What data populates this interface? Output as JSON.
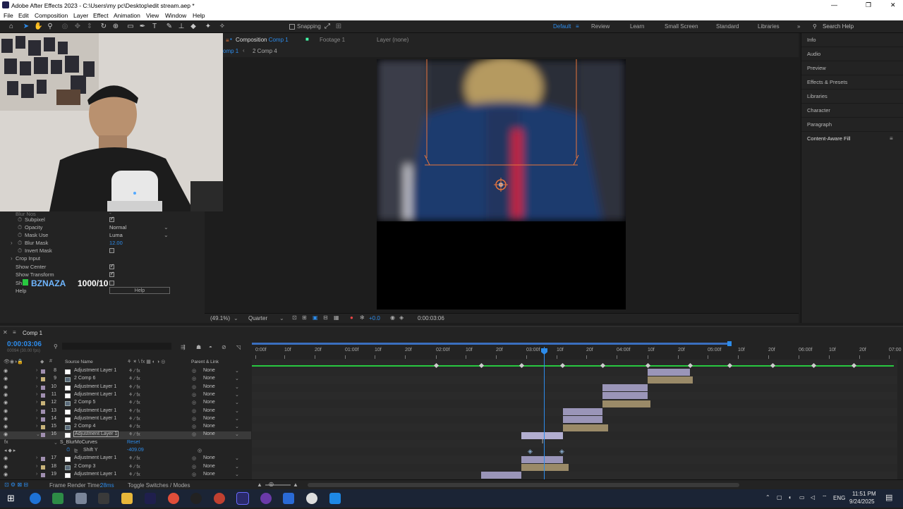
{
  "window": {
    "title": "Adobe After Effects 2023 - C:\\Users\\my pc\\Desktop\\edit stream.aep *",
    "minimize": "—",
    "restore": "❐",
    "close": "✕"
  },
  "menu": [
    "File",
    "Edit",
    "Composition",
    "Layer",
    "Effect",
    "Animation",
    "View",
    "Window",
    "Help"
  ],
  "toolbar": {
    "snapping": "Snapping",
    "workspaces": [
      "Default",
      "Review",
      "Learn",
      "Small Screen",
      "Standard",
      "Libraries"
    ],
    "active_workspace": "Default",
    "search_help": "Search Help"
  },
  "composition_panel": {
    "tabs": [
      "Composition",
      "Footage",
      "Layer (none)"
    ],
    "composition_name": "Comp 1",
    "footage_name": "1",
    "breadcrumb": [
      "omp 1",
      "2 Comp 4"
    ]
  },
  "viewer_footer": {
    "zoom": "(49.1%)",
    "resolution": "Quarter",
    "exposure": "+0.0",
    "timecode": "0:00:03:06"
  },
  "effect_controls": {
    "props": [
      {
        "label": "Subpixel",
        "type": "checkbox",
        "checked": true
      },
      {
        "label": "Opacity",
        "type": "dropdown",
        "value": "Normal"
      },
      {
        "label": "Mask Use",
        "type": "dropdown",
        "value": "Luma"
      },
      {
        "label": "Blur Mask",
        "type": "value",
        "value": "12.00"
      },
      {
        "label": "Invert Mask",
        "type": "checkbox",
        "checked": false
      },
      {
        "label": "Crop Input",
        "type": "group"
      },
      {
        "label": "Show Center",
        "type": "checkbox",
        "checked": true
      },
      {
        "label": "Show Transform",
        "type": "checkbox",
        "checked": true
      },
      {
        "label": "Sh",
        "type": "checkbox",
        "checked": false
      },
      {
        "label": "Help",
        "type": "button",
        "value": "Help"
      }
    ],
    "overlay_brand": "BZNAZA",
    "overlay_count": "1000/10"
  },
  "right_panel": {
    "items": [
      "Info",
      "Audio",
      "Preview",
      "Effects & Presets",
      "Libraries",
      "Character",
      "Paragraph",
      "Content-Aware Fill"
    ]
  },
  "timeline": {
    "tab": "Comp 1",
    "timecode": "0:00:03:06",
    "fps": "00094 (30.00 fps)",
    "columns": {
      "source": "Source Name",
      "parent": "Parent & Link"
    },
    "ruler_labels": [
      "0:00f",
      "10f",
      "20f",
      "01:00f",
      "10f",
      "20f",
      "02:00f",
      "10f",
      "20f",
      "03:00f",
      "10f",
      "20f",
      "04:00f",
      "10f",
      "20f",
      "05:00f",
      "10f",
      "20f",
      "06:00f",
      "10f",
      "20f",
      "07:00"
    ],
    "layers": [
      {
        "num": "8",
        "name": "Adjustment Layer 1",
        "kind": "adj",
        "label": "#a08fb0",
        "parent": "None"
      },
      {
        "num": "9",
        "name": "2 Comp 6",
        "kind": "comp",
        "label": "#c8b37a",
        "parent": "None"
      },
      {
        "num": "10",
        "name": "Adjustment Layer 1",
        "kind": "adj",
        "label": "#a08fb0",
        "parent": "None"
      },
      {
        "num": "11",
        "name": "Adjustment Layer 1",
        "kind": "adj",
        "label": "#a08fb0",
        "parent": "None"
      },
      {
        "num": "12",
        "name": "2 Comp 5",
        "kind": "comp",
        "label": "#c8b37a",
        "parent": "None"
      },
      {
        "num": "13",
        "name": "Adjustment Layer 1",
        "kind": "adj",
        "label": "#a08fb0",
        "parent": "None"
      },
      {
        "num": "14",
        "name": "Adjustment Layer 1",
        "kind": "adj",
        "label": "#a08fb0",
        "parent": "None"
      },
      {
        "num": "15",
        "name": "2 Comp 4",
        "kind": "comp",
        "label": "#c8b37a",
        "parent": "None"
      },
      {
        "num": "16",
        "name": "Adjustment Layer 1",
        "kind": "adj",
        "label": "#a08fb0",
        "parent": "None",
        "selected": true
      },
      {
        "num": "17",
        "name": "Adjustment Layer 1",
        "kind": "adj",
        "label": "#a08fb0",
        "parent": "None"
      },
      {
        "num": "18",
        "name": "2 Comp 3",
        "kind": "comp",
        "label": "#c8b37a",
        "parent": "None"
      },
      {
        "num": "19",
        "name": "Adjustment Layer 1",
        "kind": "adj",
        "label": "#a08fb0",
        "parent": "None"
      }
    ],
    "effect_row": {
      "name": "S_BlurMoCurves",
      "reset": "Reset"
    },
    "property_row": {
      "name": "Shift Y",
      "value": "-409.09"
    },
    "status": {
      "render_label": "Frame Render Time:",
      "render_time": "28ms",
      "toggle": "Toggle Switches / Modes"
    }
  },
  "taskbar": {
    "lang": "ENG",
    "time": "11:51 PM",
    "date": "9/24/2025"
  },
  "colors": {
    "accent": "#2d8ceb",
    "adjustment_bar": "#9a95b8",
    "comp_bar": "#9a8a68",
    "guide_orange": "#e8743b",
    "green_workarea": "#28c840"
  }
}
